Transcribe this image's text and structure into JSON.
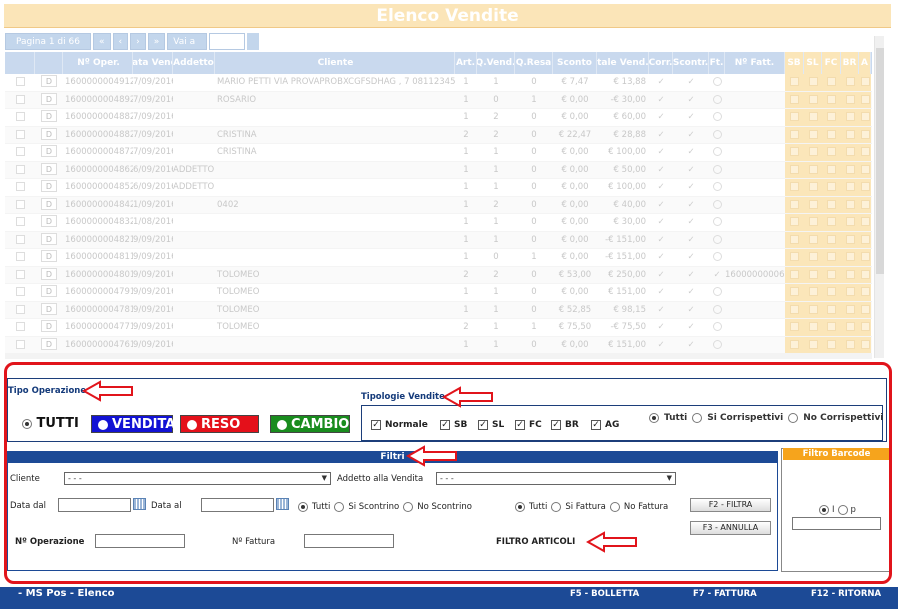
{
  "title": "Elenco Vendite",
  "pager": {
    "page_label": "Pagina 1 di 66",
    "first": "«",
    "prev": "‹",
    "next": "›",
    "last": "»",
    "goto_label": "Vai a"
  },
  "columns": [
    "",
    "",
    "Nº Oper.",
    "Data Vend.",
    "Addetto",
    "Cliente",
    "Art.",
    "Q.Vend.",
    "Q.Resa",
    "Sconto",
    "Totale Vend.ti",
    "Corr.",
    "Scontr.",
    "Ft.",
    "Nº Fatt.",
    "SB",
    "SL",
    "FC",
    "BR",
    "A"
  ],
  "rows": [
    {
      "op": "1600000004912",
      "data": "7/09/2016",
      "addetto": "",
      "cliente": "MARIO PETTI VIA PROVAPROBXCGFSDHAG , 7 081123456",
      "art": "1",
      "qv": "1",
      "qr": "0",
      "sconto": "€ 7,47",
      "totale": "€ 13,88"
    },
    {
      "op": "1600000004892",
      "data": "7/09/2016",
      "addetto": "",
      "cliente": "ROSARIO",
      "art": "1",
      "qv": "0",
      "qr": "1",
      "sconto": "€ 0,00",
      "totale": "-€ 30,00"
    },
    {
      "op": "1600000004882",
      "data": "7/09/2016",
      "addetto": "",
      "cliente": "",
      "art": "1",
      "qv": "2",
      "qr": "0",
      "sconto": "€ 0,00",
      "totale": "€ 60,00"
    },
    {
      "op": "1600000004882",
      "data": "7/09/2016",
      "addetto": "",
      "cliente": "CRISTINA",
      "art": "2",
      "qv": "2",
      "qr": "0",
      "sconto": "€ 22,47",
      "totale": "€ 28,88"
    },
    {
      "op": "1600000004872",
      "data": "7/09/2016",
      "addetto": "",
      "cliente": "CRISTINA",
      "art": "1",
      "qv": "1",
      "qr": "0",
      "sconto": "€ 0,00",
      "totale": "€ 100,00"
    },
    {
      "op": "1600000004862",
      "data": "6/09/2016",
      "addetto": "ADDETTO 1",
      "cliente": "",
      "art": "1",
      "qv": "1",
      "qr": "0",
      "sconto": "€ 0,00",
      "totale": "€ 50,00"
    },
    {
      "op": "1600000004852",
      "data": "6/09/2016",
      "addetto": "ADDETTO 1",
      "cliente": "",
      "art": "1",
      "qv": "1",
      "qr": "0",
      "sconto": "€ 0,00",
      "totale": "€ 100,00"
    },
    {
      "op": "1600000004842",
      "data": "1/09/2016",
      "addetto": "",
      "cliente": "0402",
      "art": "1",
      "qv": "2",
      "qr": "0",
      "sconto": "€ 0,00",
      "totale": "€ 40,00"
    },
    {
      "op": "1600000004832",
      "data": "1/08/2016",
      "addetto": "",
      "cliente": "",
      "art": "1",
      "qv": "1",
      "qr": "0",
      "sconto": "€ 0,00",
      "totale": "€ 30,00"
    },
    {
      "op": "1600000004821",
      "data": "9/09/2016",
      "addetto": "",
      "cliente": "",
      "art": "1",
      "qv": "1",
      "qr": "0",
      "sconto": "€ 0,00",
      "totale": "-€ 151,00"
    },
    {
      "op": "1600000004811",
      "data": "9/09/2016",
      "addetto": "",
      "cliente": "",
      "art": "1",
      "qv": "0",
      "qr": "1",
      "sconto": "€ 0,00",
      "totale": "-€ 151,00"
    },
    {
      "op": "1600000004801",
      "data": "9/09/2016",
      "addetto": "",
      "cliente": "TOLOMEO",
      "art": "2",
      "qv": "2",
      "qr": "0",
      "sconto": "€ 53,00",
      "totale": "€ 250,00",
      "fatt": "160000000060"
    },
    {
      "op": "1600000004791",
      "data": "9/09/2016",
      "addetto": "",
      "cliente": "TOLOMEO",
      "art": "1",
      "qv": "1",
      "qr": "0",
      "sconto": "€ 0,00",
      "totale": "€ 151,00"
    },
    {
      "op": "1600000004781",
      "data": "9/09/2016",
      "addetto": "",
      "cliente": "TOLOMEO",
      "art": "1",
      "qv": "1",
      "qr": "0",
      "sconto": "€ 52,85",
      "totale": "€ 98,15"
    },
    {
      "op": "1600000004771",
      "data": "9/09/2016",
      "addetto": "",
      "cliente": "TOLOMEO",
      "art": "2",
      "qv": "1",
      "qr": "1",
      "sconto": "€ 75,50",
      "totale": "-€ 75,50"
    },
    {
      "op": "1600000004761",
      "data": "9/09/2016",
      "addetto": "",
      "cliente": "",
      "art": "1",
      "qv": "1",
      "qr": "0",
      "sconto": "€ 0,00",
      "totale": "€ 151,00"
    }
  ],
  "row_button": "D",
  "tipo_operazione": {
    "label": "Tipo Operazione",
    "tutti": "TUTTI",
    "vendita": "VENDITA",
    "reso": "RESO",
    "cambio": "CAMBIO",
    "colors": {
      "vendita": "#1212d4",
      "reso": "#e4101a",
      "cambio": "#198c1e"
    }
  },
  "tipologie_vendite": {
    "label": "Tipologie Vendite",
    "items": [
      "Normale",
      "SB",
      "SL",
      "FC",
      "BR",
      "AG"
    ],
    "corr": [
      "Tutti",
      "Si Corrispettivi",
      "No Corrispettivi"
    ]
  },
  "filtri": {
    "title": "Filtri",
    "cliente_label": "Cliente",
    "cliente_value": "- - -",
    "addetto_label": "Addetto alla Vendita",
    "addetto_value": "- - -",
    "data_dal": "Data dal",
    "data_al": "Data al",
    "scontrino_opts": [
      "Tutti",
      "Si Scontrino",
      "No Scontrino"
    ],
    "fattura_opts": [
      "Tutti",
      "Si Fattura",
      "No Fattura"
    ],
    "btn_filtra": "F2 - FILTRA",
    "btn_annulla": "F3 - ANNULLA",
    "n_operazione": "Nº Operazione",
    "n_fattura": "Nº Fattura",
    "filtro_articoli": "FILTRO ARTICOLI"
  },
  "barcode": {
    "title": "Filtro Barcode",
    "opt1": "I",
    "opt2": "p"
  },
  "footer": {
    "app": "- MS Pos - Elenco",
    "f5": "F5 - BOLLETTA",
    "f7": "F7 - FATTURA",
    "f12": "F12 - RITORNA"
  }
}
